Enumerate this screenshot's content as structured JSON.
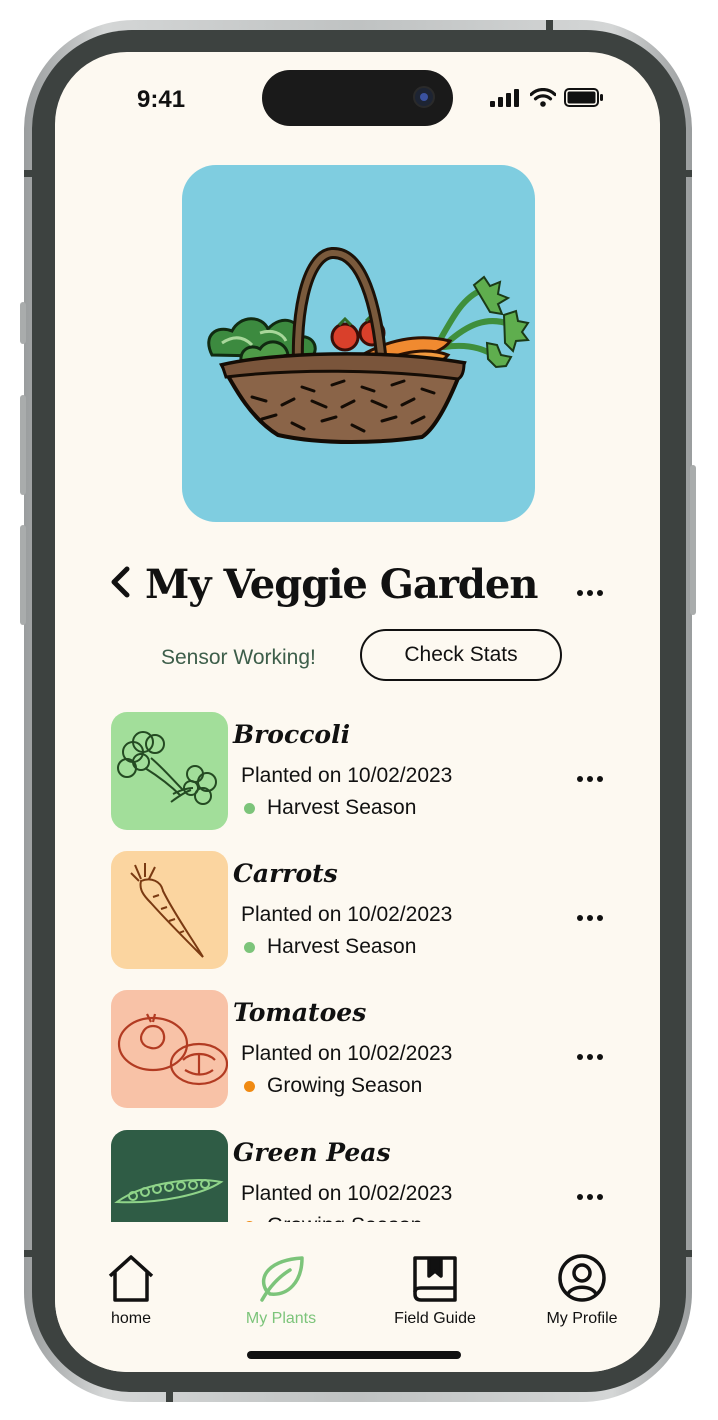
{
  "status_bar": {
    "time": "9:41"
  },
  "garden": {
    "title": "My Veggie Garden"
  },
  "sensor": {
    "status": "Sensor Working!",
    "button_label": "Check Stats"
  },
  "colors": {
    "harvest": "#7cc47a",
    "growing": "#f08a12",
    "accent": "#7cc47a"
  },
  "plants": [
    {
      "name": "Broccoli",
      "planted": "Planted on 10/02/2023",
      "status": "Harvest Season",
      "status_color": "#7cc47a",
      "thumb_color": "#a2de9a",
      "icon": "broccoli-icon"
    },
    {
      "name": "Carrots",
      "planted": "Planted on 10/02/2023",
      "status": "Harvest Season",
      "status_color": "#7cc47a",
      "thumb_color": "#fbd5a0",
      "icon": "carrot-icon"
    },
    {
      "name": "Tomatoes",
      "planted": "Planted on 10/02/2023",
      "status": "Growing Season",
      "status_color": "#f08a12",
      "thumb_color": "#f8c2a7",
      "icon": "tomato-icon"
    },
    {
      "name": "Green Peas",
      "planted": "Planted on 10/02/2023",
      "status": "Growing Season",
      "status_color": "#f08a12",
      "thumb_color": "#2f5c45",
      "icon": "pea-pod-icon"
    }
  ],
  "nav": {
    "home": "home",
    "my_plants": "My Plants",
    "field_guide": "Field Guide",
    "my_profile": "My Profile",
    "active": "my_plants"
  }
}
